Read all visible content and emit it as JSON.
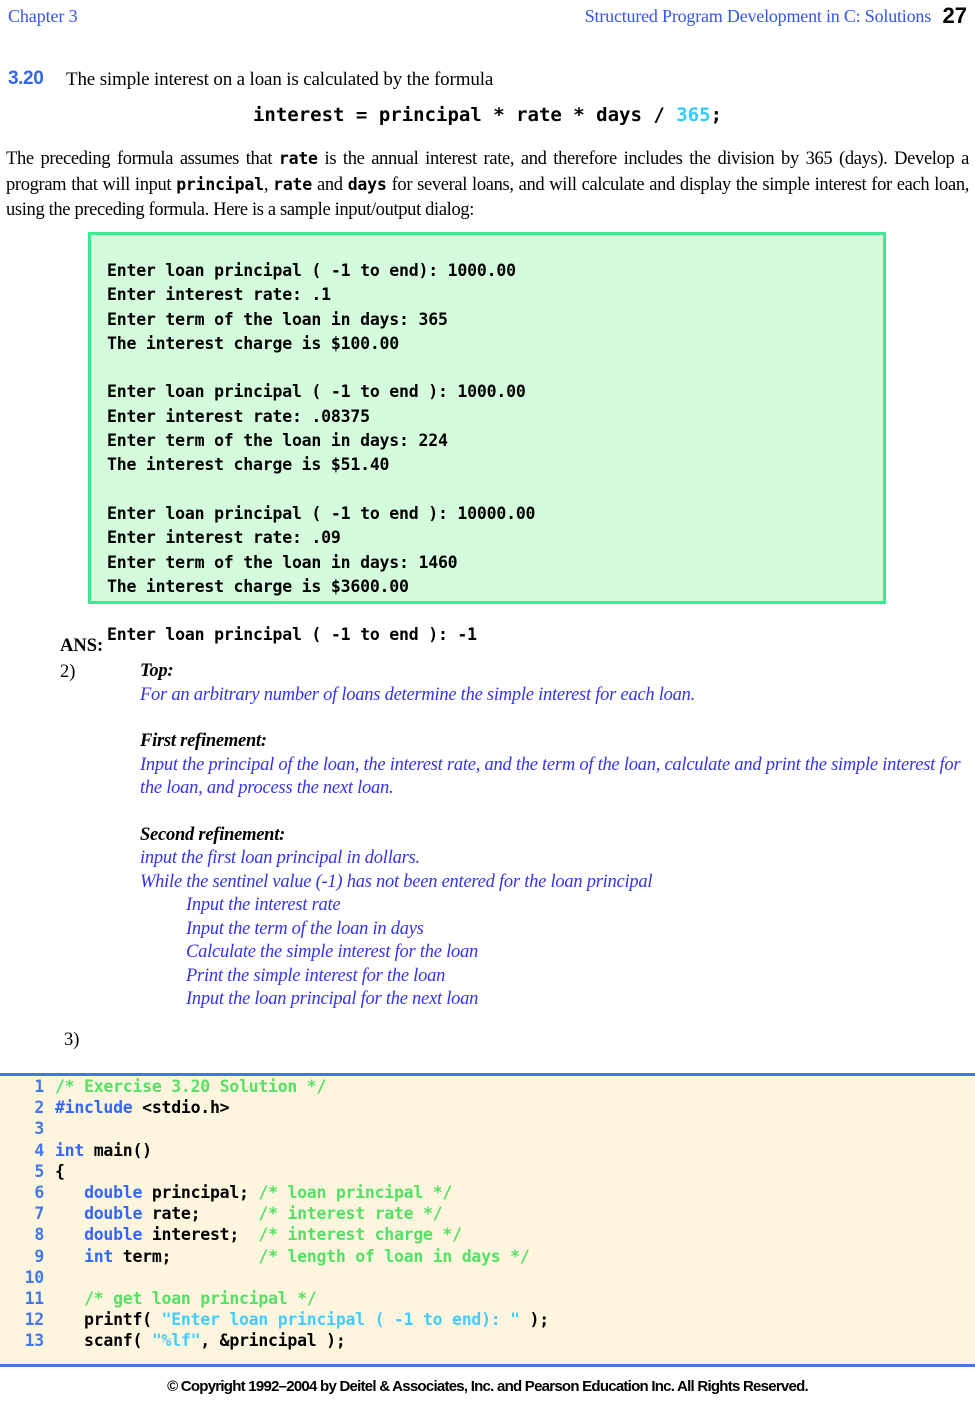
{
  "header": {
    "left": "Chapter 3",
    "title": "Structured Program Development in C: Solutions",
    "page_number": "27",
    "link_color": "#3355ee"
  },
  "exercise": {
    "number": "3.20",
    "lead_text": "The simple interest on a loan is calculated by the formula",
    "formula": {
      "prefix": "interest = principal * rate * days / ",
      "literal": "365",
      "suffix": ";",
      "literal_color": "#33ccff"
    },
    "paragraph": {
      "p1": "The preceding formula assumes that ",
      "c1": "rate",
      "p2": " is the annual interest rate, and therefore includes the division by 365 (days). Develop a program that will input ",
      "c2": "principal",
      "p3": ", ",
      "c3": "rate",
      "p4": " and ",
      "c4": "days",
      "p5": " for several loans, and will calculate and display the simple interest for each loan, using the preceding formula.  Here is a sample input/output dialog:"
    }
  },
  "sample_dialog": {
    "background": "#d5fbdd",
    "border_color": "#33ef93",
    "text": "Enter loan principal ( -1 to end): 1000.00\nEnter interest rate: .1\nEnter term of the loan in days: 365\nThe interest charge is $100.00\n\nEnter loan principal ( -1 to end ): 1000.00\nEnter interest rate: .08375\nEnter term of the loan in days: 224\nThe interest charge is $51.40\n\nEnter loan principal ( -1 to end ): 10000.00\nEnter interest rate: .09\nEnter term of the loan in days: 1460\nThe interest charge is $3600.00\n\nEnter loan principal ( -1 to end ): -1"
  },
  "answer": {
    "label": "ANS:",
    "item_2": "2)",
    "item_3": "3)",
    "pseudocode_color": "#3333ee",
    "blocks": {
      "top_heading": "Top:",
      "top_line": "For an arbitrary number of loans determine the simple interest for each loan.",
      "first_heading": "First refinement:",
      "first_line": "Input the principal of the loan, the interest rate, and the term of the loan, calculate and print the simple interest for the loan, and process the next loan.",
      "second_heading": "Second refinement:",
      "second_lines": [
        "input the first loan principal in dollars.",
        "While the sentinel value (-1) has not been entered for the loan principal",
        "Input the interest rate",
        "Input the term of the loan in days",
        "Calculate the simple interest for the loan",
        "Print the simple interest for the loan",
        "Input the loan principal for the next loan"
      ]
    }
  },
  "code_listing": {
    "background": "#fdf5dd",
    "rule_color": "#4477dd",
    "line_number_color": "#4477ee",
    "comment_color": "#55e066",
    "keyword_color": "#3366ff",
    "string_color": "#44ccff",
    "lines": [
      {
        "n": "1",
        "segments": [
          {
            "t": "/* Exercise 3.20 Solution */",
            "c": "cmt"
          }
        ]
      },
      {
        "n": "2",
        "segments": [
          {
            "t": "#include",
            "c": "pp"
          },
          {
            "t": " <stdio.h>",
            "c": "cl"
          }
        ]
      },
      {
        "n": "3",
        "segments": [
          {
            "t": "",
            "c": "cl"
          }
        ]
      },
      {
        "n": "4",
        "segments": [
          {
            "t": "int",
            "c": "kw"
          },
          {
            "t": " main()",
            "c": "cl"
          }
        ]
      },
      {
        "n": "5",
        "segments": [
          {
            "t": "{",
            "c": "cl"
          }
        ]
      },
      {
        "n": "6",
        "segments": [
          {
            "t": "   ",
            "c": "cl"
          },
          {
            "t": "double",
            "c": "kw"
          },
          {
            "t": " principal; ",
            "c": "cl"
          },
          {
            "t": "/* loan principal */",
            "c": "cmt"
          }
        ]
      },
      {
        "n": "7",
        "segments": [
          {
            "t": "   ",
            "c": "cl"
          },
          {
            "t": "double",
            "c": "kw"
          },
          {
            "t": " rate;      ",
            "c": "cl"
          },
          {
            "t": "/* interest rate */",
            "c": "cmt"
          }
        ]
      },
      {
        "n": "8",
        "segments": [
          {
            "t": "   ",
            "c": "cl"
          },
          {
            "t": "double",
            "c": "kw"
          },
          {
            "t": " interest;  ",
            "c": "cl"
          },
          {
            "t": "/* interest charge */",
            "c": "cmt"
          }
        ]
      },
      {
        "n": "9",
        "segments": [
          {
            "t": "   ",
            "c": "cl"
          },
          {
            "t": "int",
            "c": "kw"
          },
          {
            "t": " term;         ",
            "c": "cl"
          },
          {
            "t": "/* length of loan in days */",
            "c": "cmt"
          }
        ]
      },
      {
        "n": "10",
        "segments": [
          {
            "t": "",
            "c": "cl"
          }
        ]
      },
      {
        "n": "11",
        "segments": [
          {
            "t": "   ",
            "c": "cl"
          },
          {
            "t": "/* get loan principal */",
            "c": "cmt"
          }
        ]
      },
      {
        "n": "12",
        "segments": [
          {
            "t": "   printf( ",
            "c": "cl"
          },
          {
            "t": "\"Enter loan principal ( -1 to end): \"",
            "c": "str"
          },
          {
            "t": " );",
            "c": "cl"
          }
        ]
      },
      {
        "n": "13",
        "segments": [
          {
            "t": "   scanf( ",
            "c": "cl"
          },
          {
            "t": "\"%lf\"",
            "c": "str"
          },
          {
            "t": ", &principal );",
            "c": "cl"
          }
        ]
      }
    ]
  },
  "footer": {
    "text": "© Copyright 1992–2004 by Deitel & Associates, Inc. and Pearson Education Inc. All Rights Reserved."
  }
}
